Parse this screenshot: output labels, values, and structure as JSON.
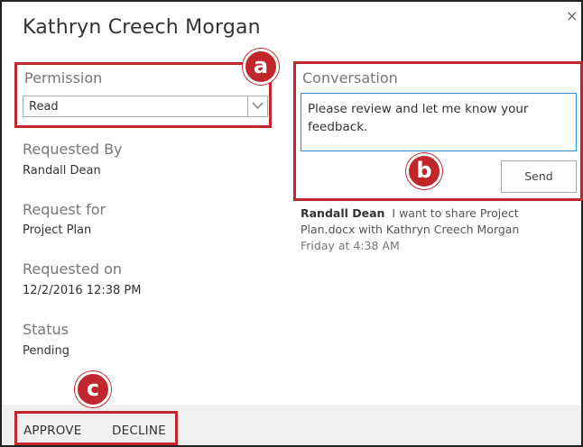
{
  "dialog": {
    "title": "Kathryn Creech Morgan",
    "close_icon": "×"
  },
  "permission": {
    "label": "Permission",
    "selected": "Read"
  },
  "details": [
    {
      "label": "Requested By",
      "value": "Randall Dean"
    },
    {
      "label": "Request for",
      "value": "Project Plan"
    },
    {
      "label": "Requested on",
      "value": "12/2/2016 12:38 PM"
    },
    {
      "label": "Status",
      "value": "Pending"
    }
  ],
  "conversation": {
    "label": "Conversation",
    "input_value": "Please review and let me know your feedback.",
    "send_label": "Send",
    "message": {
      "author": "Randall Dean",
      "text": "I want to share Project Plan.docx with Kathryn Creech Morgan",
      "time": "Friday at 4:38 AM"
    }
  },
  "footer": {
    "approve_label": "APPROVE",
    "decline_label": "DECLINE"
  },
  "callouts": {
    "a": "a",
    "b": "b",
    "c": "c",
    "color": "#c0272d"
  },
  "colors": {
    "input_border_focus": "#2a8dd4",
    "footer_bg": "#f0f0f0"
  }
}
